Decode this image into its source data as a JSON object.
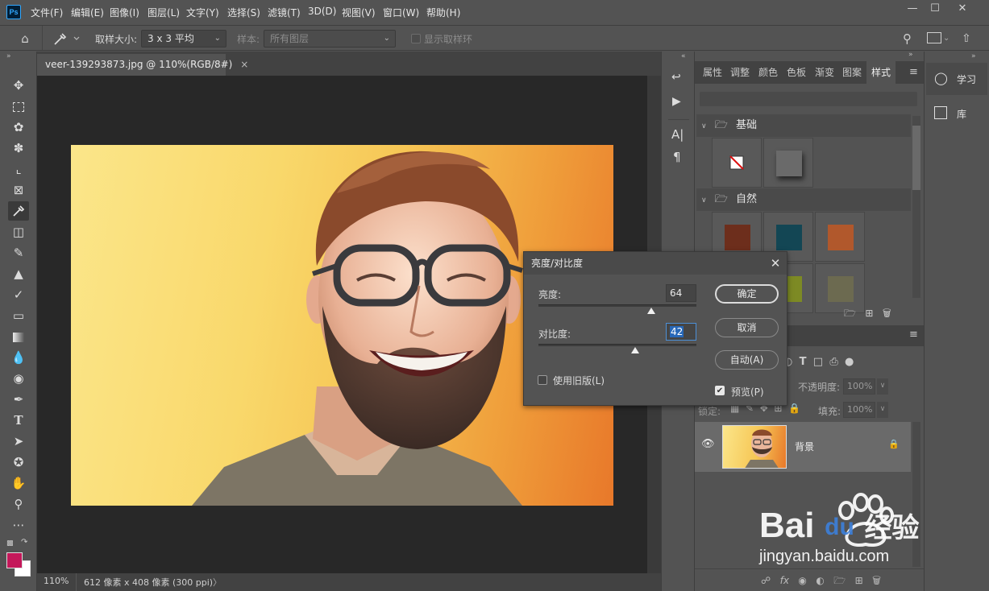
{
  "app": {
    "logo": "Ps",
    "menu": [
      "文件(F)",
      "编辑(E)",
      "图像(I)",
      "图层(L)",
      "文字(Y)",
      "选择(S)",
      "滤镜(T)",
      "3D(D)",
      "视图(V)",
      "窗口(W)",
      "帮助(H)"
    ],
    "window_controls": [
      "minimize-icon",
      "maximize-icon",
      "close-icon"
    ]
  },
  "options": {
    "sample_size_label": "取样大小:",
    "sample_size_value": "3 x 3 平均",
    "sample_label": "样本:",
    "sample_value": "所有图层",
    "show_ring_label": "显示取样环"
  },
  "document": {
    "tab_title": "veer-139293873.jpg @ 110%(RGB/8#)",
    "close_glyph": "×",
    "zoom": "110%",
    "info": "612 像素 x 408 像素 (300 ppi)",
    "status_arrow": "〉"
  },
  "panels": {
    "tabs": [
      "属性",
      "调整",
      "颜色",
      "色板",
      "渐变",
      "图案",
      "样式"
    ],
    "active_tab": "样式",
    "style_groups": [
      "基础",
      "自然"
    ],
    "learn_label": "学习",
    "library_label": "库"
  },
  "layers": {
    "opacity_label": "不透明度:",
    "opacity_value": "100%",
    "lock_label": "锁定:",
    "fill_label": "填充:",
    "fill_value": "100%",
    "layer_name": "背景"
  },
  "dialog": {
    "title": "亮度/对比度",
    "brightness_label": "亮度:",
    "brightness_value": "64",
    "brightness_level": 64,
    "contrast_label": "对比度:",
    "contrast_value": "42",
    "contrast_level": 42,
    "legacy_label": "使用旧版(L)",
    "legacy_checked": false,
    "ok_label": "确定",
    "cancel_label": "取消",
    "auto_label": "自动(A)",
    "preview_label": "预览(P)",
    "preview_checked": true
  },
  "watermark": {
    "brand_a": "Bai",
    "brand_b": "du",
    "brand_c": "经验",
    "url": "jingyan.baidu.com"
  },
  "colors": {
    "foreground": "#c4185a",
    "background": "#ffffff",
    "accent": "#31a8ff"
  }
}
